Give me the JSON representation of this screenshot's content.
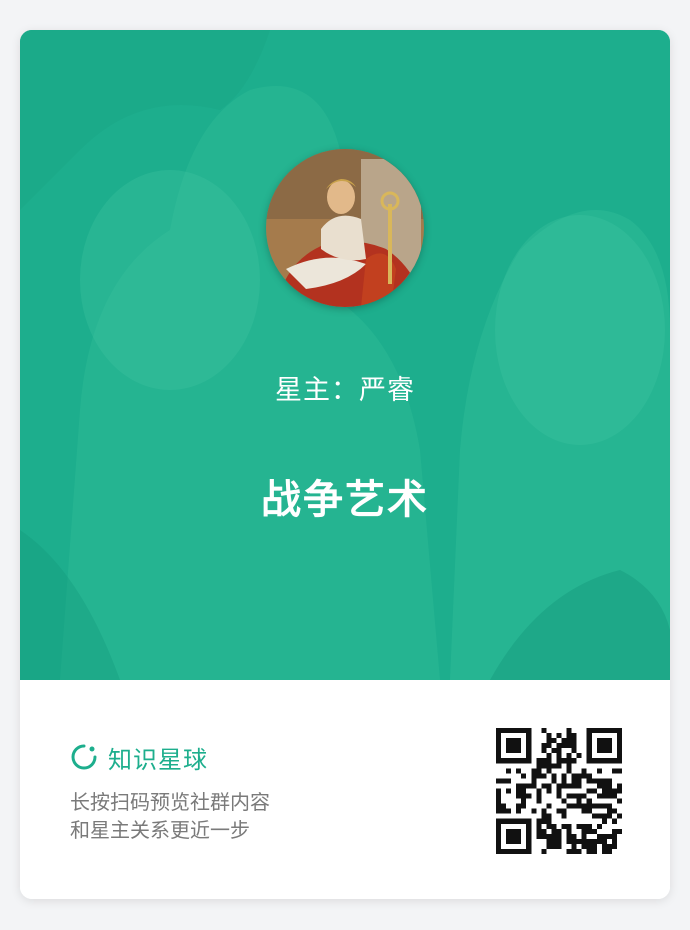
{
  "card": {
    "owner_text": "星主：严睿",
    "title": "战争艺术",
    "accent_color": "#1dae8d"
  },
  "brand": {
    "name": "知识星球",
    "icon": "circle-arc-icon"
  },
  "description": {
    "line1": "长按扫码预览社群内容",
    "line2": "和星主关系更近一步"
  },
  "qr_code": {
    "icon": "qr-code-icon"
  },
  "avatar": {
    "icon": "portrait-avatar"
  }
}
